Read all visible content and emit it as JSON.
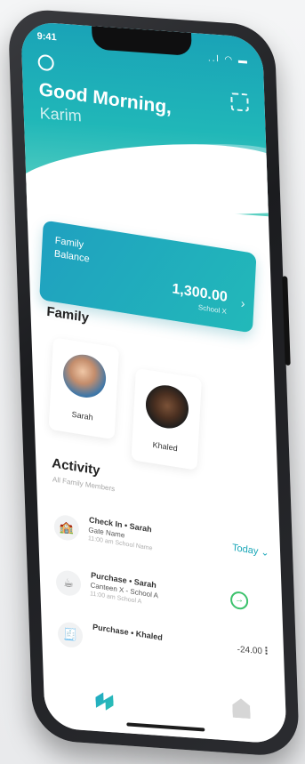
{
  "status": {
    "time": "9:41",
    "indicators": "..l ◠ ▬"
  },
  "header": {
    "greeting": "Good Morning,",
    "user_name": "Karim"
  },
  "balance": {
    "label": "Family Balance",
    "amount": "1,300.00",
    "school": "School X",
    "chevron": "›"
  },
  "family": {
    "title": "Family",
    "members": [
      {
        "name": "Sarah"
      },
      {
        "name": "Khaled"
      }
    ]
  },
  "activity": {
    "title": "Activity",
    "subtitle": "All Family Members",
    "filter_label": "Today ⌄",
    "items": [
      {
        "title": "Check In • Sarah",
        "place": "Gate Name",
        "time": "11:00 am School Name",
        "amount": "",
        "icon": "school-gate-icon"
      },
      {
        "title": "Purchase • Sarah",
        "place": "Canteen X - School A",
        "time": "11:00 am School A",
        "amount": "",
        "icon": "cup-icon"
      },
      {
        "title": "Purchase • Khaled",
        "place": "",
        "time": "",
        "amount": "-24.00",
        "icon": "receipt-icon"
      }
    ]
  },
  "icons": {
    "profile": "profile-icon",
    "scan": "scan-icon",
    "logo": "brand-logo",
    "school_nav": "school-icon",
    "enter": "enter-icon",
    "more": "more-vertical-icon"
  },
  "colors": {
    "header_top": "#1aa3b7",
    "header_bottom": "#5bd0c2",
    "accent": "#1aa7b8",
    "success": "#3cc26c"
  }
}
